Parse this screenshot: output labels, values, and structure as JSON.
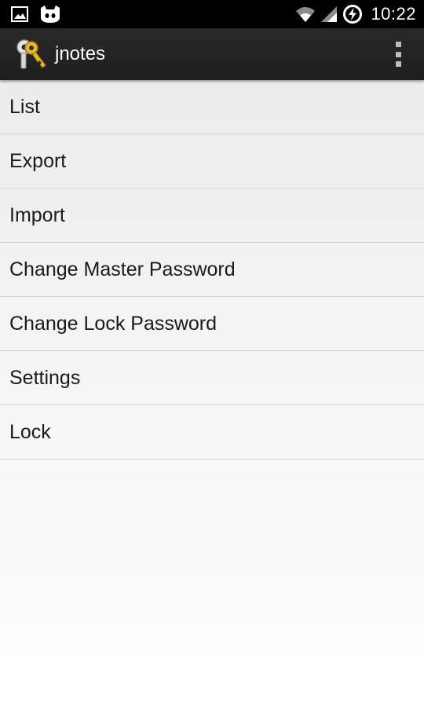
{
  "status_bar": {
    "time": "10:22",
    "left_icons": [
      "image-icon",
      "cyanogen-mascot-icon"
    ],
    "right_icons": [
      "wifi-icon",
      "signal-icon",
      "battery-charging-icon"
    ]
  },
  "action_bar": {
    "title": "jnotes",
    "app_icon": "keys-icon",
    "overflow_icon": "overflow-menu-icon"
  },
  "menu": {
    "items": [
      {
        "label": "List"
      },
      {
        "label": "Export"
      },
      {
        "label": "Import"
      },
      {
        "label": "Change Master Password"
      },
      {
        "label": "Change Lock Password"
      },
      {
        "label": "Settings"
      },
      {
        "label": "Lock"
      }
    ]
  },
  "colors": {
    "status_bar": "#000000",
    "action_bar": "#222222",
    "list_background": "#ececec",
    "divider": "#d2d2d2",
    "text": "#1a1a1a"
  }
}
